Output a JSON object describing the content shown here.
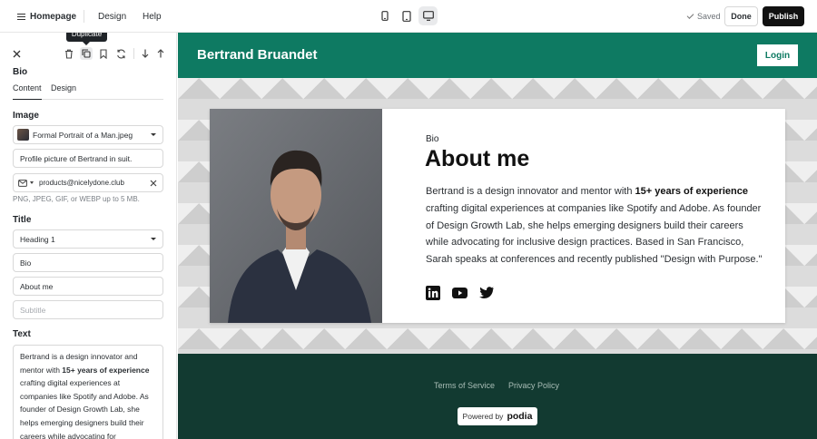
{
  "topbar": {
    "menu_label": "Homepage",
    "design_label": "Design",
    "help_label": "Help",
    "devices": [
      "mobile",
      "tablet",
      "desktop"
    ],
    "active_device": "desktop",
    "status": "Saved",
    "done_label": "Done",
    "publish_label": "Publish"
  },
  "panel": {
    "tooltip": "Duplicate",
    "block_title": "Bio",
    "tabs": [
      "Content",
      "Design"
    ],
    "active_tab": "Content",
    "image": {
      "heading": "Image",
      "file_name": "Formal Portrait of a Man.jpeg",
      "alt_text": "Profile picture of Bertrand in suit.",
      "link_value": "products@nicelydone.club",
      "hint": "PNG, JPEG, GIF, or WEBP up to 5 MB."
    },
    "title": {
      "heading": "Title",
      "style": "Heading 1",
      "kicker": "Bio",
      "text": "About me",
      "subtitle_placeholder": "Subtitle"
    },
    "text": {
      "heading": "Text",
      "pre": "Bertrand is a design innovator and mentor with ",
      "bold": "15+ years of experience",
      "post": " crafting digital experiences at companies like Spotify and Adobe. As founder of Design Growth Lab, she helps emerging designers build their careers while advocating for"
    }
  },
  "preview": {
    "site_name": "Bertrand Bruandet",
    "login_label": "Login",
    "bio_kicker": "Bio",
    "bio_heading": "About me",
    "bio_pre": "Bertrand is a design innovator and mentor with ",
    "bio_bold": "15+ years of experience",
    "bio_post": " crafting digital experiences at companies like Spotify and Adobe. As founder of Design Growth Lab, she helps emerging designers build their careers while advocating for inclusive design practices. Based in San Francisco, Sarah speaks at conferences and recently published \"Design with Purpose.\"",
    "social_icons": [
      "linkedin-icon",
      "youtube-icon",
      "twitter-icon"
    ],
    "footer_links": [
      "Terms of Service",
      "Privacy Policy"
    ],
    "powered_by": "Powered by",
    "powered_brand": "podia"
  },
  "colors": {
    "brand_green": "#0e7a62",
    "footer_green": "#123a31",
    "publish_black": "#111111"
  }
}
